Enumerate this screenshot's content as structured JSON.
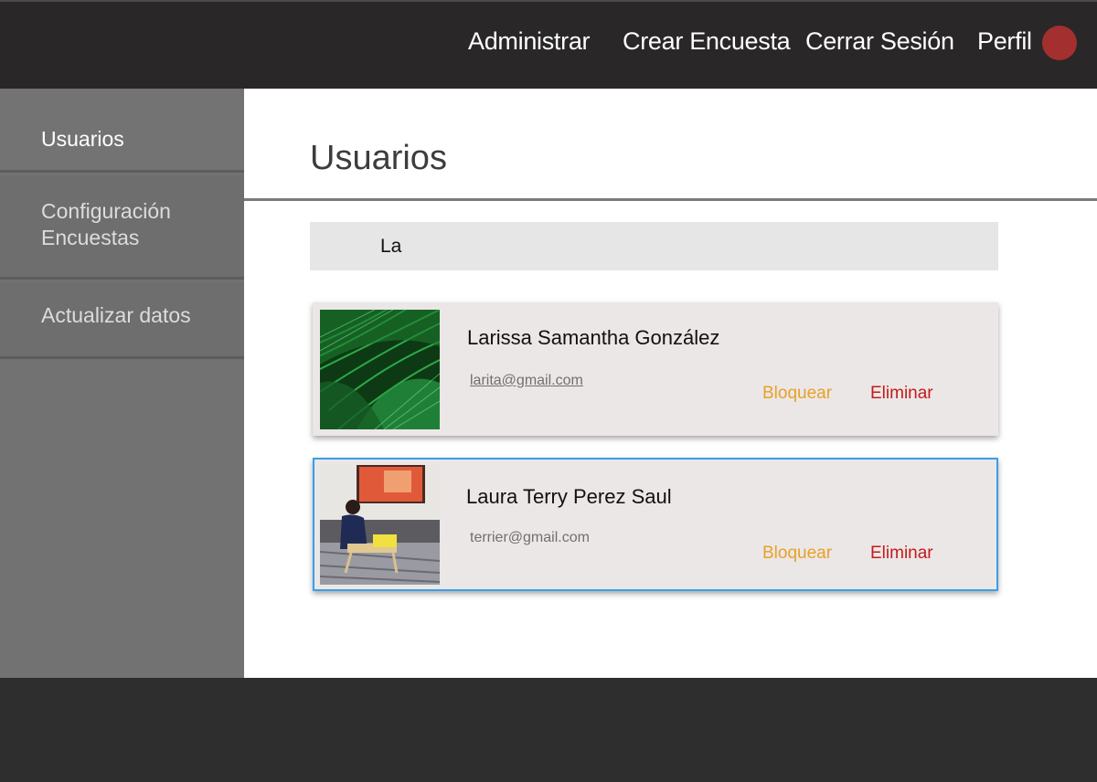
{
  "nav": {
    "links": [
      "Administrar",
      "Crear Encuesta",
      "Cerrar Sesión",
      "Perfil"
    ],
    "avatar_color": "#a42f2f"
  },
  "sidebar": {
    "items": [
      {
        "label": "Usuarios"
      },
      {
        "label": "Configuración\nEncuestas"
      },
      {
        "label": "Actualizar datos"
      }
    ]
  },
  "main": {
    "title": "Usuarios",
    "search_value": "La",
    "users": [
      {
        "name": "Larissa Samantha González",
        "email": "larita@gmail.com",
        "block_label": "Bloquear",
        "delete_label": "Eliminar",
        "photo": "green-fan-palm-leaves"
      },
      {
        "name": "Laura Terry Perez Saul",
        "email": "terrier@gmail.com",
        "block_label": "Bloquear",
        "delete_label": "Eliminar",
        "photo": "person-on-bed-with-tray"
      }
    ]
  },
  "colors": {
    "block": "#e8a12a",
    "delete": "#c41b1b",
    "selected_border": "#3a9ee8"
  }
}
